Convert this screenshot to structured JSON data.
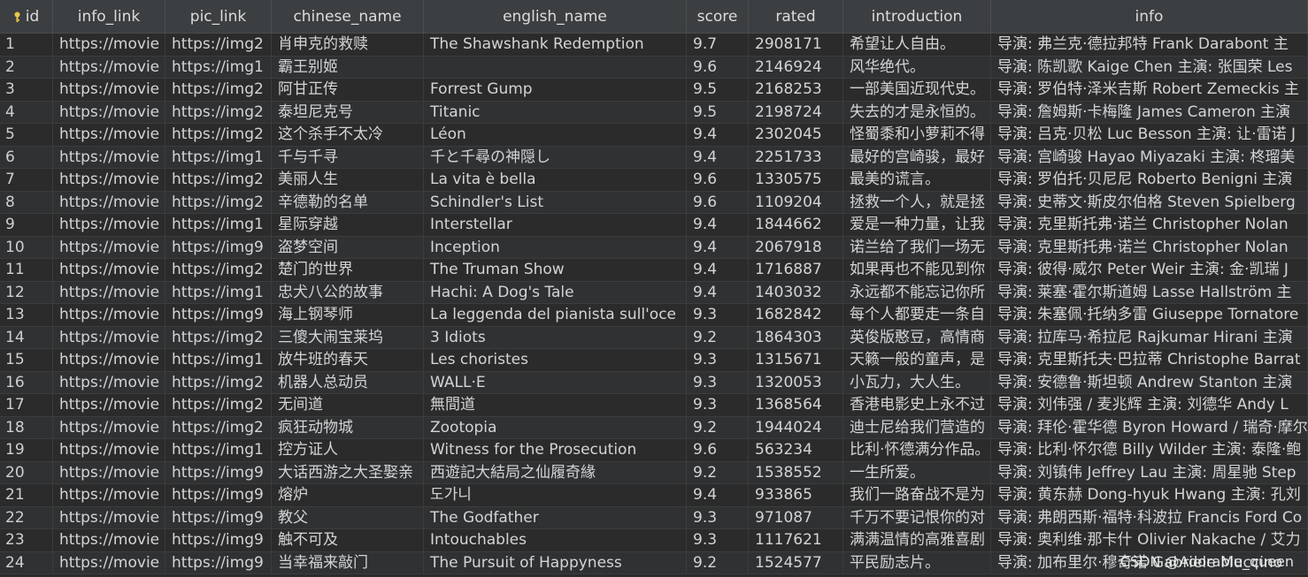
{
  "columns": [
    "id",
    "info_link",
    "pic_link",
    "chinese_name",
    "english_name",
    "score",
    "rated",
    "introduction",
    "info"
  ],
  "rows": [
    {
      "id": "1",
      "info_link": "https://movie",
      "pic_link": "https://img2",
      "chinese_name": "肖申克的救赎",
      "english_name": "The Shawshank Redemption",
      "score": "9.7",
      "rated": "2908171",
      "introduction": "希望让人自由。",
      "info": "导演: 弗兰克·德拉邦特 Frank Darabont  主"
    },
    {
      "id": "2",
      "info_link": "https://movie",
      "pic_link": "https://img1",
      "chinese_name": "霸王别姬",
      "english_name": "",
      "score": "9.6",
      "rated": "2146924",
      "introduction": "风华绝代。",
      "info": "导演: 陈凯歌 Kaige Chen  主演: 张国荣 Les"
    },
    {
      "id": "3",
      "info_link": "https://movie",
      "pic_link": "https://img2",
      "chinese_name": "阿甘正传",
      "english_name": "Forrest Gump",
      "score": "9.5",
      "rated": "2168253",
      "introduction": "一部美国近现代史。",
      "info": "导演: 罗伯特·泽米吉斯 Robert Zemeckis  主"
    },
    {
      "id": "4",
      "info_link": "https://movie",
      "pic_link": "https://img2",
      "chinese_name": "泰坦尼克号",
      "english_name": "Titanic",
      "score": "9.5",
      "rated": "2198724",
      "introduction": "失去的才是永恒的。",
      "info": "导演: 詹姆斯·卡梅隆 James Cameron  主演"
    },
    {
      "id": "5",
      "info_link": "https://movie",
      "pic_link": "https://img2",
      "chinese_name": "这个杀手不太冷",
      "english_name": "Léon",
      "score": "9.4",
      "rated": "2302045",
      "introduction": "怪蜀黍和小萝莉不得",
      "info": "导演: 吕克·贝松 Luc Besson  主演: 让·雷诺 J"
    },
    {
      "id": "6",
      "info_link": "https://movie",
      "pic_link": "https://img1",
      "chinese_name": "千与千寻",
      "english_name": "千と千尋の神隠し",
      "score": "9.4",
      "rated": "2251733",
      "introduction": "最好的宫崎骏，最好",
      "info": "导演: 宫崎骏 Hayao Miyazaki  主演: 柊瑠美"
    },
    {
      "id": "7",
      "info_link": "https://movie",
      "pic_link": "https://img2",
      "chinese_name": "美丽人生",
      "english_name": "La vita è bella",
      "score": "9.6",
      "rated": "1330575",
      "introduction": "最美的谎言。",
      "info": "导演: 罗伯托·贝尼尼 Roberto Benigni  主演"
    },
    {
      "id": "8",
      "info_link": "https://movie",
      "pic_link": "https://img2",
      "chinese_name": "辛德勒的名单",
      "english_name": "Schindler's List",
      "score": "9.6",
      "rated": "1109204",
      "introduction": "拯救一个人，就是拯",
      "info": "导演: 史蒂文·斯皮尔伯格 Steven Spielberg"
    },
    {
      "id": "9",
      "info_link": "https://movie",
      "pic_link": "https://img1",
      "chinese_name": "星际穿越",
      "english_name": "Interstellar",
      "score": "9.4",
      "rated": "1844662",
      "introduction": "爱是一种力量，让我",
      "info": "导演: 克里斯托弗·诺兰 Christopher Nolan"
    },
    {
      "id": "10",
      "info_link": "https://movie",
      "pic_link": "https://img9",
      "chinese_name": "盗梦空间",
      "english_name": "Inception",
      "score": "9.4",
      "rated": "2067918",
      "introduction": "诺兰给了我们一场无",
      "info": "导演: 克里斯托弗·诺兰 Christopher Nolan"
    },
    {
      "id": "11",
      "info_link": "https://movie",
      "pic_link": "https://img2",
      "chinese_name": "楚门的世界",
      "english_name": "The Truman Show",
      "score": "9.4",
      "rated": "1716887",
      "introduction": "如果再也不能见到你",
      "info": "导演: 彼得·威尔 Peter Weir  主演: 金·凯瑞 J"
    },
    {
      "id": "12",
      "info_link": "https://movie",
      "pic_link": "https://img1",
      "chinese_name": "忠犬八公的故事",
      "english_name": "Hachi: A Dog's Tale",
      "score": "9.4",
      "rated": "1403032",
      "introduction": "永远都不能忘记你所",
      "info": "导演: 莱塞·霍尔斯道姆 Lasse Hallström  主"
    },
    {
      "id": "13",
      "info_link": "https://movie",
      "pic_link": "https://img9",
      "chinese_name": "海上钢琴师",
      "english_name": "La leggenda del pianista sull'oce",
      "score": "9.3",
      "rated": "1682842",
      "introduction": "每个人都要走一条自",
      "info": "导演: 朱塞佩·托纳多雷 Giuseppe Tornatore"
    },
    {
      "id": "14",
      "info_link": "https://movie",
      "pic_link": "https://img2",
      "chinese_name": "三傻大闹宝莱坞",
      "english_name": "3 Idiots",
      "score": "9.2",
      "rated": "1864303",
      "introduction": "英俊版憨豆，高情商",
      "info": "导演: 拉库马·希拉尼 Rajkumar Hirani  主演"
    },
    {
      "id": "15",
      "info_link": "https://movie",
      "pic_link": "https://img1",
      "chinese_name": "放牛班的春天",
      "english_name": "Les choristes",
      "score": "9.3",
      "rated": "1315671",
      "introduction": "天籁一般的童声，是",
      "info": "导演: 克里斯托夫·巴拉蒂 Christophe Barrat"
    },
    {
      "id": "16",
      "info_link": "https://movie",
      "pic_link": "https://img2",
      "chinese_name": "机器人总动员",
      "english_name": "WALL·E",
      "score": "9.3",
      "rated": "1320053",
      "introduction": "小瓦力，大人生。",
      "info": "导演: 安德鲁·斯坦顿 Andrew Stanton  主演"
    },
    {
      "id": "17",
      "info_link": "https://movie",
      "pic_link": "https://img2",
      "chinese_name": "无间道",
      "english_name": "無間道",
      "score": "9.3",
      "rated": "1368564",
      "introduction": "香港电影史上永不过",
      "info": "导演: 刘伟强 / 麦兆辉  主演: 刘德华 Andy L"
    },
    {
      "id": "18",
      "info_link": "https://movie",
      "pic_link": "https://img2",
      "chinese_name": "疯狂动物城",
      "english_name": "Zootopia",
      "score": "9.2",
      "rated": "1944024",
      "introduction": "迪士尼给我们营造的",
      "info": "导演: 拜伦·霍华德 Byron Howard / 瑞奇·摩尔"
    },
    {
      "id": "19",
      "info_link": "https://movie",
      "pic_link": "https://img1",
      "chinese_name": "控方证人",
      "english_name": "Witness for the Prosecution",
      "score": "9.6",
      "rated": "563234",
      "introduction": "比利·怀德满分作品。",
      "info": "导演: 比利·怀尔德 Billy Wilder  主演: 泰隆·鲍"
    },
    {
      "id": "20",
      "info_link": "https://movie",
      "pic_link": "https://img9",
      "chinese_name": "大话西游之大圣娶亲",
      "english_name": "西遊記大結局之仙履奇緣",
      "score": "9.2",
      "rated": "1538552",
      "introduction": "一生所爱。",
      "info": "导演: 刘镇伟 Jeffrey Lau  主演: 周星驰 Step"
    },
    {
      "id": "21",
      "info_link": "https://movie",
      "pic_link": "https://img9",
      "chinese_name": "熔炉",
      "english_name": "도가니",
      "score": "9.4",
      "rated": "933865",
      "introduction": "我们一路奋战不是为",
      "info": "导演: 黄东赫 Dong-hyuk Hwang  主演: 孔刘"
    },
    {
      "id": "22",
      "info_link": "https://movie",
      "pic_link": "https://img9",
      "chinese_name": "教父",
      "english_name": "The Godfather",
      "score": "9.3",
      "rated": "971087",
      "introduction": "千万不要记恨你的对",
      "info": "导演: 弗朗西斯·福特·科波拉 Francis Ford Co"
    },
    {
      "id": "23",
      "info_link": "https://movie",
      "pic_link": "https://img9",
      "chinese_name": "触不可及",
      "english_name": "Intouchables",
      "score": "9.3",
      "rated": "1117621",
      "introduction": "满满温情的高雅喜剧",
      "info": "导演: 奥利维·那卡什 Olivier Nakache / 艾力"
    },
    {
      "id": "24",
      "info_link": "https://movie",
      "pic_link": "https://img9",
      "chinese_name": "当幸福来敲门",
      "english_name": "The Pursuit of Happyness",
      "score": "9.2",
      "rated": "1524577",
      "introduction": "平民励志片。",
      "info": "导演: 加布里尔·穆奇诺 Gabriele Muccino"
    }
  ],
  "watermark": "CSDN @Adorable_queen",
  "colors": {
    "background": "#2b2b2b",
    "header": "#3c3f41",
    "key_icon": "#e8c84a"
  }
}
